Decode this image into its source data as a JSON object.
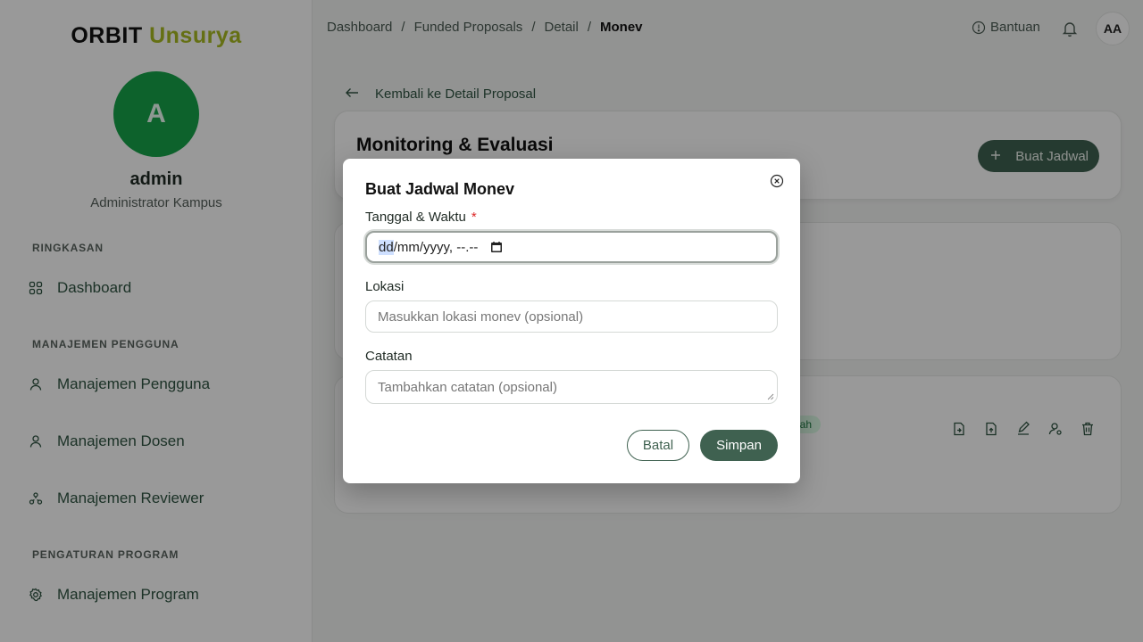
{
  "sidebar": {
    "brand_primary": "ORBIT",
    "brand_secondary": "Unsurya",
    "avatar_initial": "A",
    "user_name": "admin",
    "user_role": "Administrator Kampus",
    "sections": [
      {
        "label": "RINGKASAN",
        "items": [
          {
            "label": "Dashboard",
            "icon": "grid-icon"
          }
        ]
      },
      {
        "label": "MANAJEMEN PENGGUNA",
        "items": [
          {
            "label": "Manajemen Pengguna",
            "icon": "user-icon"
          },
          {
            "label": "Manajemen Dosen",
            "icon": "user-icon"
          },
          {
            "label": "Manajemen Reviewer",
            "icon": "users-network-icon"
          }
        ]
      },
      {
        "label": "PENGATURAN PROGRAM",
        "items": [
          {
            "label": "Manajemen Program",
            "icon": "gear-icon"
          }
        ]
      }
    ]
  },
  "topbar": {
    "breadcrumb": [
      "Dashboard",
      "Funded Proposals",
      "Detail",
      "Monev"
    ],
    "separator": "/",
    "help_label": "Bantuan",
    "avatar_initials": "AA"
  },
  "main": {
    "back_label": "Kembali ke Detail Proposal",
    "page_title": "Monitoring & Evaluasi",
    "add_button_label": "Buat Jadwal",
    "badge_text": "gah"
  },
  "modal": {
    "title": "Buat Jadwal Monev",
    "date_label": "Tanggal & Waktu",
    "required_mark": "*",
    "date_value_selected": "dd",
    "date_value_rest": "/mm/yyyy, --.--",
    "location_label": "Lokasi",
    "location_placeholder": "Masukkan lokasi monev (opsional)",
    "notes_label": "Catatan",
    "notes_placeholder": "Tambahkan catatan (opsional)",
    "cancel_label": "Batal",
    "save_label": "Simpan"
  },
  "colors": {
    "primary": "#3f6150",
    "brand_accent": "#a9bb22",
    "avatar_green": "#16a34a"
  }
}
